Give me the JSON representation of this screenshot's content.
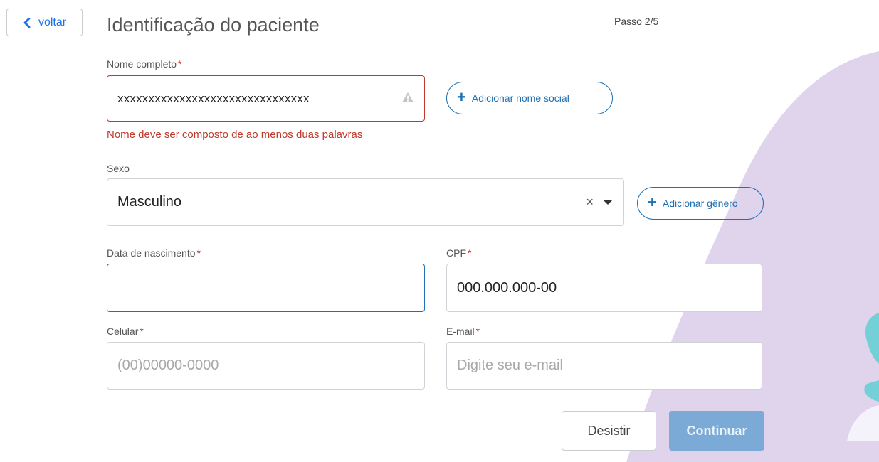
{
  "header": {
    "back_label": "voltar",
    "title": "Identificação do paciente",
    "step": "Passo 2/5"
  },
  "form": {
    "name": {
      "label": "Nome completo",
      "required_mark": "*",
      "value": "xxxxxxxxxxxxxxxxxxxxxxxxxxxxxxx",
      "error": "Nome deve ser composto de ao menos duas palavras"
    },
    "social_name_button": "Adicionar nome social",
    "sex": {
      "label": "Sexo",
      "value": "Masculino",
      "clear": "×"
    },
    "gender_button": "Adicionar gênero",
    "birthdate": {
      "label": "Data de nascimento",
      "required_mark": "*",
      "value": ""
    },
    "cpf": {
      "label": "CPF",
      "required_mark": "*",
      "value": "000.000.000-00"
    },
    "phone": {
      "label": "Celular",
      "required_mark": "*",
      "placeholder": "(00)00000-0000"
    },
    "email": {
      "label": "E-mail",
      "required_mark": "*",
      "placeholder": "Digite seu e-mail"
    }
  },
  "actions": {
    "cancel": "Desistir",
    "continue": "Continuar"
  },
  "colors": {
    "accent": "#1f6fb2",
    "error": "#c0392b",
    "decor_lavender": "#e0d3ec",
    "decor_teal": "#72d0d6",
    "continue_disabled": "#7baad6"
  }
}
